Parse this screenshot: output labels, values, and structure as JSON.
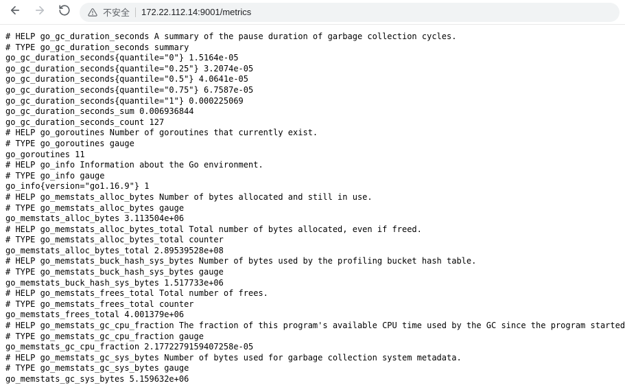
{
  "toolbar": {
    "security_label": "不安全",
    "url": "172.22.112.14:9001/metrics"
  },
  "metrics": {
    "lines": [
      "# HELP go_gc_duration_seconds A summary of the pause duration of garbage collection cycles.",
      "# TYPE go_gc_duration_seconds summary",
      "go_gc_duration_seconds{quantile=\"0\"} 1.5164e-05",
      "go_gc_duration_seconds{quantile=\"0.25\"} 3.2074e-05",
      "go_gc_duration_seconds{quantile=\"0.5\"} 4.0641e-05",
      "go_gc_duration_seconds{quantile=\"0.75\"} 6.7587e-05",
      "go_gc_duration_seconds{quantile=\"1\"} 0.000225069",
      "go_gc_duration_seconds_sum 0.006936844",
      "go_gc_duration_seconds_count 127",
      "# HELP go_goroutines Number of goroutines that currently exist.",
      "# TYPE go_goroutines gauge",
      "go_goroutines 11",
      "# HELP go_info Information about the Go environment.",
      "# TYPE go_info gauge",
      "go_info{version=\"go1.16.9\"} 1",
      "# HELP go_memstats_alloc_bytes Number of bytes allocated and still in use.",
      "# TYPE go_memstats_alloc_bytes gauge",
      "go_memstats_alloc_bytes 3.113504e+06",
      "# HELP go_memstats_alloc_bytes_total Total number of bytes allocated, even if freed.",
      "# TYPE go_memstats_alloc_bytes_total counter",
      "go_memstats_alloc_bytes_total 2.89539528e+08",
      "# HELP go_memstats_buck_hash_sys_bytes Number of bytes used by the profiling bucket hash table.",
      "# TYPE go_memstats_buck_hash_sys_bytes gauge",
      "go_memstats_buck_hash_sys_bytes 1.517733e+06",
      "# HELP go_memstats_frees_total Total number of frees.",
      "# TYPE go_memstats_frees_total counter",
      "go_memstats_frees_total 4.001379e+06",
      "# HELP go_memstats_gc_cpu_fraction The fraction of this program's available CPU time used by the GC since the program started.",
      "# TYPE go_memstats_gc_cpu_fraction gauge",
      "go_memstats_gc_cpu_fraction 2.1772279159407258e-05",
      "# HELP go_memstats_gc_sys_bytes Number of bytes used for garbage collection system metadata.",
      "# TYPE go_memstats_gc_sys_bytes gauge",
      "go_memstats_gc_sys_bytes 5.159632e+06"
    ]
  }
}
